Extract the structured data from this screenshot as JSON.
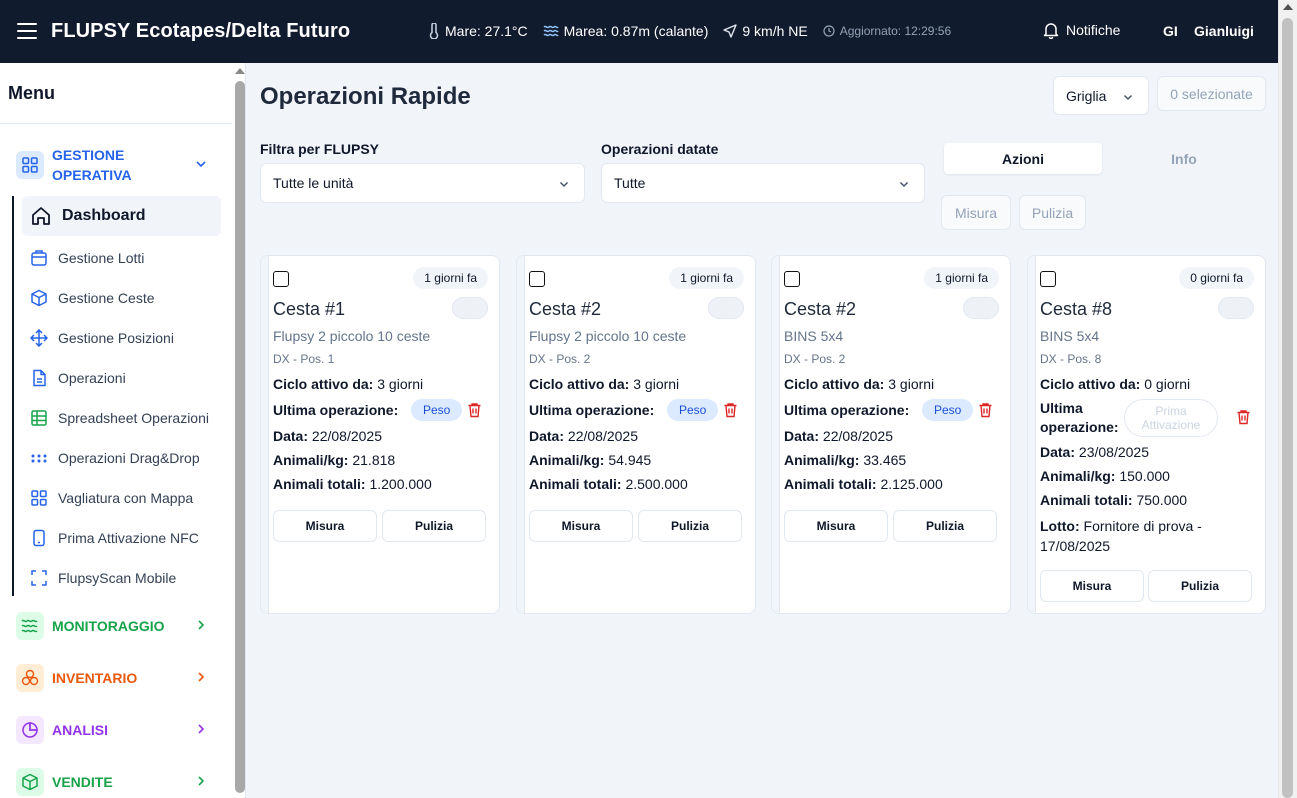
{
  "header": {
    "app_title": "FLUPSY Ecotapes/Delta Futuro",
    "sea_temp": "Mare: 27.1°C",
    "tide": "Marea: 0.87m (calante)",
    "wind": "9 km/h NE",
    "updated": "Aggiornato: 12:29:56",
    "notifications": "Notifiche",
    "user_initials": "GI",
    "user_name": "Gianluigi"
  },
  "sidebar": {
    "title": "Menu",
    "groups": [
      {
        "label_line1": "GESTIONE",
        "label_line2": "OPERATIVA",
        "color": "#2563eb",
        "icon": "grid-icon"
      },
      {
        "label": "MONITORAGGIO",
        "color": "#16a34a",
        "icon": "waves-icon"
      },
      {
        "label": "INVENTARIO",
        "color": "#ea580c",
        "icon": "boxes-icon"
      },
      {
        "label": "ANALISI",
        "color": "#9333ea",
        "icon": "pie-chart-icon"
      },
      {
        "label": "VENDITE",
        "color": "#16a34a",
        "icon": "package-icon"
      }
    ],
    "items": [
      {
        "label": "Dashboard",
        "icon": "home-icon"
      },
      {
        "label": "Gestione Lotti",
        "icon": "briefcase-icon"
      },
      {
        "label": "Gestione Ceste",
        "icon": "box-icon"
      },
      {
        "label": "Gestione Posizioni",
        "icon": "move-icon"
      },
      {
        "label": "Operazioni",
        "icon": "file-icon"
      },
      {
        "label": "Spreadsheet Operazioni",
        "icon": "table-icon"
      },
      {
        "label": "Operazioni Drag&Drop",
        "icon": "dots-icon"
      },
      {
        "label": "Vagliatura con Mappa",
        "icon": "grid-icon"
      },
      {
        "label": "Prima Attivazione NFC",
        "icon": "phone-icon"
      },
      {
        "label": "FlupsyScan Mobile",
        "icon": "scan-icon"
      }
    ]
  },
  "main": {
    "title": "Operazioni Rapide",
    "view_mode": "Griglia",
    "selected_count": "0 selezionate",
    "filter_flupsy_label": "Filtra per FLUPSY",
    "filter_flupsy_value": "Tutte le unità",
    "filter_dated_label": "Operazioni datate",
    "filter_dated_value": "Tutte",
    "tab_actions": "Azioni",
    "tab_info": "Info",
    "bulk_measure": "Misura",
    "bulk_clean": "Pulizia"
  },
  "labels": {
    "cycle": "Ciclo attivo da:",
    "last_op": "Ultima operazione:",
    "last_op_l1": "Ultima",
    "last_op_l2": "operazione:",
    "date": "Data:",
    "animals_kg": "Animali/kg:",
    "animals_total": "Animali totali:",
    "lot": "Lotto:",
    "btn_measure": "Misura",
    "btn_clean": "Pulizia"
  },
  "cards": [
    {
      "badge": "1 giorni fa",
      "title": "Cesta #1",
      "flupsy": "Flupsy 2 piccolo 10 ceste",
      "position": "DX - Pos. 1",
      "cycle": "3 giorni",
      "op": "Peso",
      "date": "22/08/2025",
      "animals_kg": "21.818",
      "animals_total": "1.200.000"
    },
    {
      "badge": "1 giorni fa",
      "title": "Cesta #2",
      "flupsy": "Flupsy 2 piccolo 10 ceste",
      "position": "DX - Pos. 2",
      "cycle": "3 giorni",
      "op": "Peso",
      "date": "22/08/2025",
      "animals_kg": "54.945",
      "animals_total": "2.500.000"
    },
    {
      "badge": "1 giorni fa",
      "title": "Cesta #2",
      "flupsy": "BINS 5x4",
      "position": "DX - Pos. 2",
      "cycle": "3 giorni",
      "op": "Peso",
      "date": "22/08/2025",
      "animals_kg": "33.465",
      "animals_total": "2.125.000"
    },
    {
      "badge": "0 giorni fa",
      "title": "Cesta #8",
      "flupsy": "BINS 5x4",
      "position": "DX - Pos. 8",
      "cycle": "0 giorni",
      "op_l1": "Prima",
      "op_l2": "Attivazione",
      "date": "23/08/2025",
      "animals_kg": "150.000",
      "animals_total": "750.000",
      "lot_l1": "Fornitore di prova -",
      "lot_l2": "17/08/2025"
    }
  ]
}
